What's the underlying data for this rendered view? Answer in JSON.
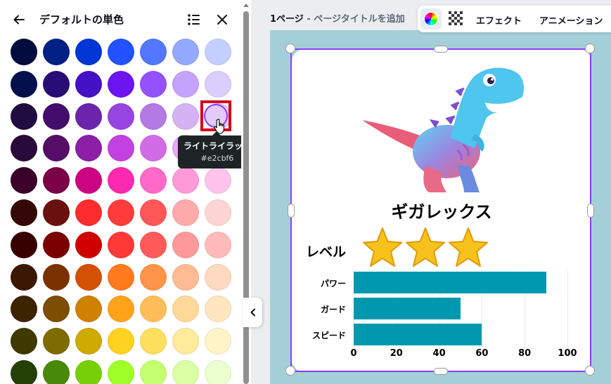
{
  "panel": {
    "title": "デフォルトの単色",
    "swatch_rows": [
      [
        "#020c3d",
        "#012086",
        "#0236d4",
        "#2152fe",
        "#5378fd",
        "#93a9fd",
        "#c3d0ff"
      ],
      [
        "#02114e",
        "#290d76",
        "#4412c4",
        "#6c15ee",
        "#9451fe",
        "#c3a3fb",
        "#dbcefd"
      ],
      [
        "#200c3e",
        "#430e6b",
        "#6d24ad",
        "#9844e0",
        "#b47ae4",
        "#d5b2f4",
        "#e2cbf6"
      ],
      [
        "#2a0a3a",
        "#550e68",
        "#8c1ea8",
        "#c241e1",
        "#d16ce6",
        "#e6a9f2",
        "#f3d4fa"
      ],
      [
        "#3a0228",
        "#7b0246",
        "#cc0484",
        "#fc2ab0",
        "#ff69c7",
        "#ff9ad9",
        "#ffc4eb"
      ],
      [
        "#330806",
        "#6a1110",
        "#fd2c2d",
        "#ff3d3d",
        "#ff5757",
        "#ffabab",
        "#ffd4d4"
      ],
      [
        "#370000",
        "#7b0000",
        "#d00000",
        "#ff3838",
        "#ff5a5a",
        "#ff9999",
        "#ffbaba"
      ],
      [
        "#3b1803",
        "#7a3203",
        "#d25105",
        "#ff7b1d",
        "#ff944a",
        "#ffbb93",
        "#ffd9c0"
      ],
      [
        "#3d2401",
        "#7c4d02",
        "#d08002",
        "#ffa31a",
        "#ffbd59",
        "#ffd89a",
        "#ffe6c0"
      ],
      [
        "#3e3a01",
        "#7e6b02",
        "#ceaa02",
        "#ffd21f",
        "#ffdf5e",
        "#ffeb9b",
        "#fff4c7"
      ],
      [
        "#244005",
        "#488909",
        "#77cf06",
        "#a1ff28",
        "#c3ff6f",
        "#dcffa5",
        "#ecffce"
      ]
    ],
    "tooltip": {
      "name": "ライトライラック",
      "hex": "#e2cbf6"
    },
    "selected_color": "#e2cbf6"
  },
  "editor": {
    "page_number": "1ページ",
    "separator": " - ",
    "page_title_placeholder": "ページタイトルを追加",
    "toolbar": {
      "effects": "エフェクト",
      "animation": "アニメーション"
    },
    "accent_color": "#8b3dff",
    "canvas_bg": "#a5cfd8"
  },
  "card": {
    "dino_name": "ギガレックス",
    "level_label": "レベル",
    "level_stars": 3,
    "chart_data": {
      "type": "bar",
      "orientation": "horizontal",
      "categories": [
        "パワー",
        "ガード",
        "スピード"
      ],
      "values": [
        90,
        50,
        60
      ],
      "xlim": [
        0,
        100
      ],
      "ticks": [
        "0",
        "20",
        "40",
        "60",
        "80",
        "100"
      ],
      "bar_color": "#0098ae",
      "grid": true
    }
  }
}
